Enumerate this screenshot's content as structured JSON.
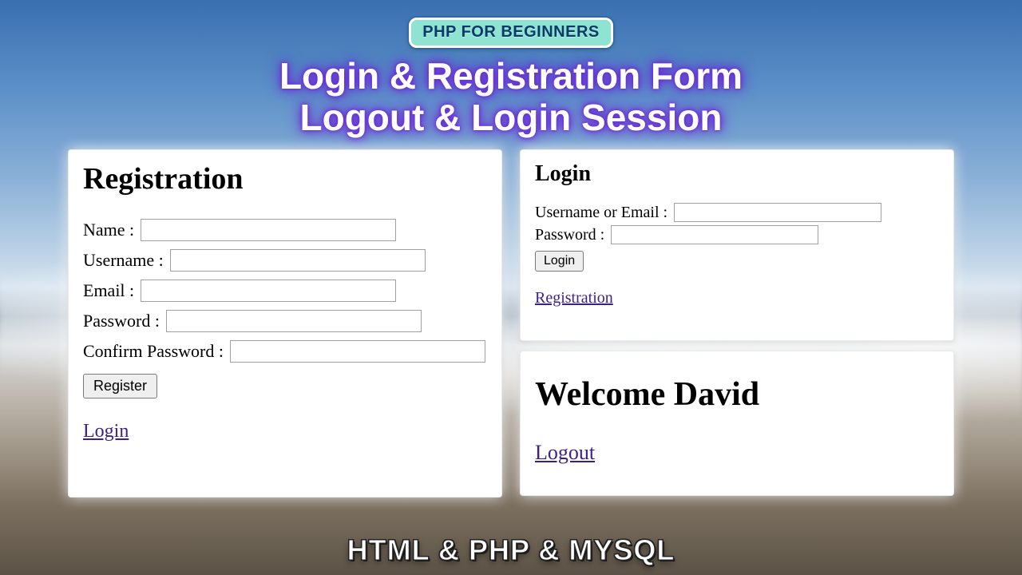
{
  "badge": "PHP FOR BEGINNERS",
  "title_line1": "Login & Registration Form",
  "title_line2": "Logout & Login Session",
  "footer": "HTML & PHP & MYSQL",
  "registration": {
    "heading": "Registration",
    "fields": {
      "name_label": "Name :",
      "username_label": "Username :",
      "email_label": "Email :",
      "password_label": "Password :",
      "confirm_label": "Confirm Password :"
    },
    "button": "Register",
    "link": "Login"
  },
  "login": {
    "heading": "Login",
    "fields": {
      "user_label": "Username or Email :",
      "password_label": "Password :"
    },
    "button": "Login",
    "link": "Registration"
  },
  "welcome": {
    "heading": "Welcome David",
    "link": "Logout"
  }
}
